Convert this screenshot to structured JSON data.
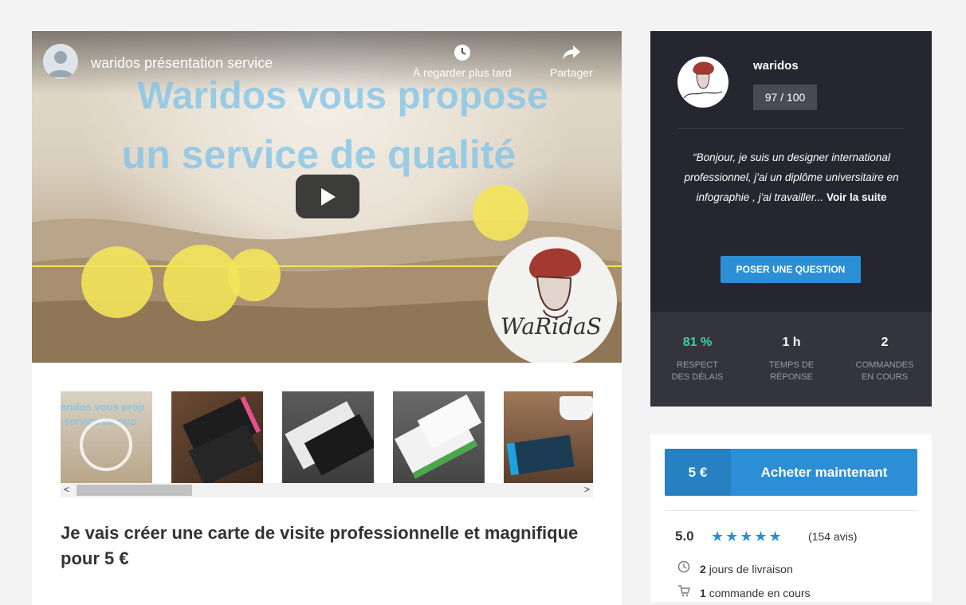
{
  "video": {
    "title": "waridos présentation service",
    "watch_later_label": "À regarder plus tard",
    "share_label": "Partager",
    "overlay_line1": "Waridos vous propose",
    "overlay_line2": "un service de qualité",
    "logo_text": "WaRidaS"
  },
  "thumbnails": {
    "first_overlay_line1": "aridos vous prop",
    "first_overlay_line2": "service de quo",
    "scroll_left": "<",
    "scroll_right": ">"
  },
  "service": {
    "title": "Je vais créer une carte de visite professionnelle et magnifique pour 5 €"
  },
  "seller": {
    "name": "waridos",
    "score": "97 / 100",
    "bio": "“Bonjour, je suis un designer international professionnel, j'ai un diplôme universitaire en infographie , j'ai travailler...",
    "bio_more": "Voir la suite",
    "ask_button": "POSER UNE QUESTION",
    "stats": [
      {
        "value": "81 %",
        "label_line1": "RESPECT",
        "label_line2": "DES DÉLAIS"
      },
      {
        "value": "1 h",
        "label_line1": "TEMPS DE",
        "label_line2": "RÉPONSE"
      },
      {
        "value": "2",
        "label_line1": "COMMANDES",
        "label_line2": "EN COURS"
      }
    ]
  },
  "buy": {
    "price": "5 €",
    "label": "Acheter maintenant",
    "rating": "5.0",
    "stars": "★★★★★",
    "reviews": "(154 avis)",
    "delivery_count": "2",
    "delivery_text": "jours de livraison",
    "orders_count": "1",
    "orders_text": "commande en cours"
  },
  "colors": {
    "accent": "#2c8fd6",
    "dark_panel": "#262631",
    "success": "#3ed3a0"
  }
}
